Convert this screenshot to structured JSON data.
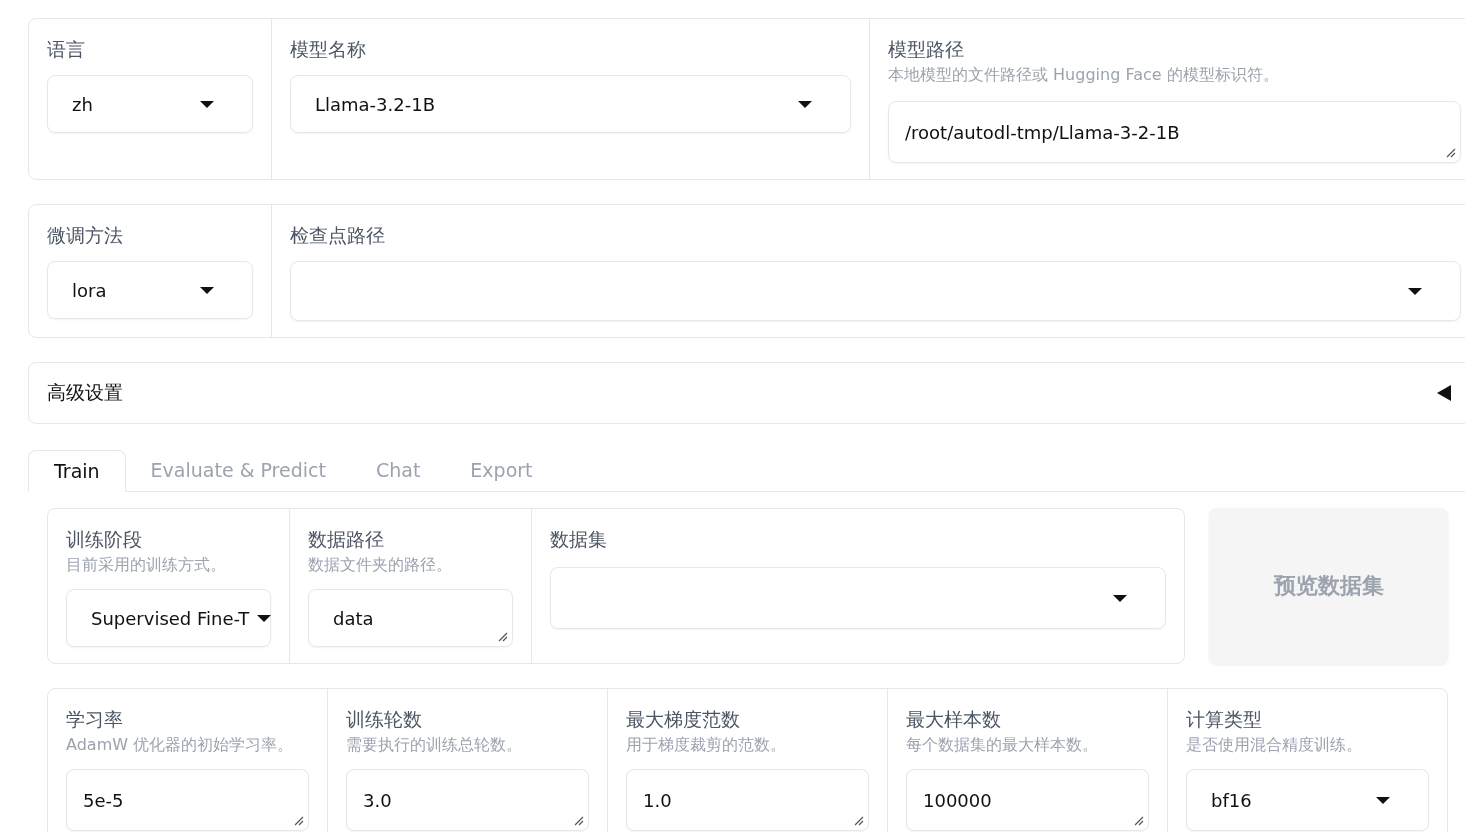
{
  "model_row": [
    {
      "kind": "dropdown",
      "label": "语言",
      "value": "zh"
    },
    {
      "kind": "dropdown",
      "label": "模型名称",
      "value": "Llama-3.2-1B"
    },
    {
      "kind": "textbox",
      "label": "模型路径",
      "info": "本地模型的文件路径或 Hugging Face 的模型标识符。",
      "value": "/root/autodl-tmp/Llama-3-2-1B"
    }
  ],
  "method_row": [
    {
      "kind": "dropdown",
      "label": "微调方法",
      "value": "lora"
    },
    {
      "kind": "dropdown",
      "label": "检查点路径"
    }
  ],
  "advanced": {
    "title": "高级设置",
    "expanded": false
  },
  "tabs": [
    {
      "label": "Train",
      "selected": true
    },
    {
      "label": "Evaluate & Predict",
      "selected": false
    },
    {
      "label": "Chat",
      "selected": false
    },
    {
      "label": "Export",
      "selected": false
    }
  ],
  "data_row": [
    {
      "kind": "dropdown",
      "label": "训练阶段",
      "info": "目前采用的训练方式。",
      "value": "Supervised Fine-T"
    },
    {
      "kind": "textbox",
      "label": "数据路径",
      "info": "数据文件夹的路径。",
      "value": "data"
    },
    {
      "kind": "dropdown",
      "label": "数据集"
    }
  ],
  "preview_button": {
    "label": "预览数据集",
    "disabled": true
  },
  "param_row": [
    {
      "kind": "textbox",
      "label": "学习率",
      "info": "AdamW 优化器的初始学习率。",
      "value": "5e-5"
    },
    {
      "kind": "textbox",
      "label": "训练轮数",
      "info": "需要执行的训练总轮数。",
      "value": "3.0"
    },
    {
      "kind": "textbox",
      "label": "最大梯度范数",
      "info": "用于梯度裁剪的范数。",
      "value": "1.0"
    },
    {
      "kind": "textbox",
      "label": "最大样本数",
      "info": "每个数据集的最大样本数。",
      "value": "100000"
    },
    {
      "kind": "dropdown",
      "label": "计算类型",
      "info": "是否使用混合精度训练。",
      "value": "bf16"
    }
  ]
}
